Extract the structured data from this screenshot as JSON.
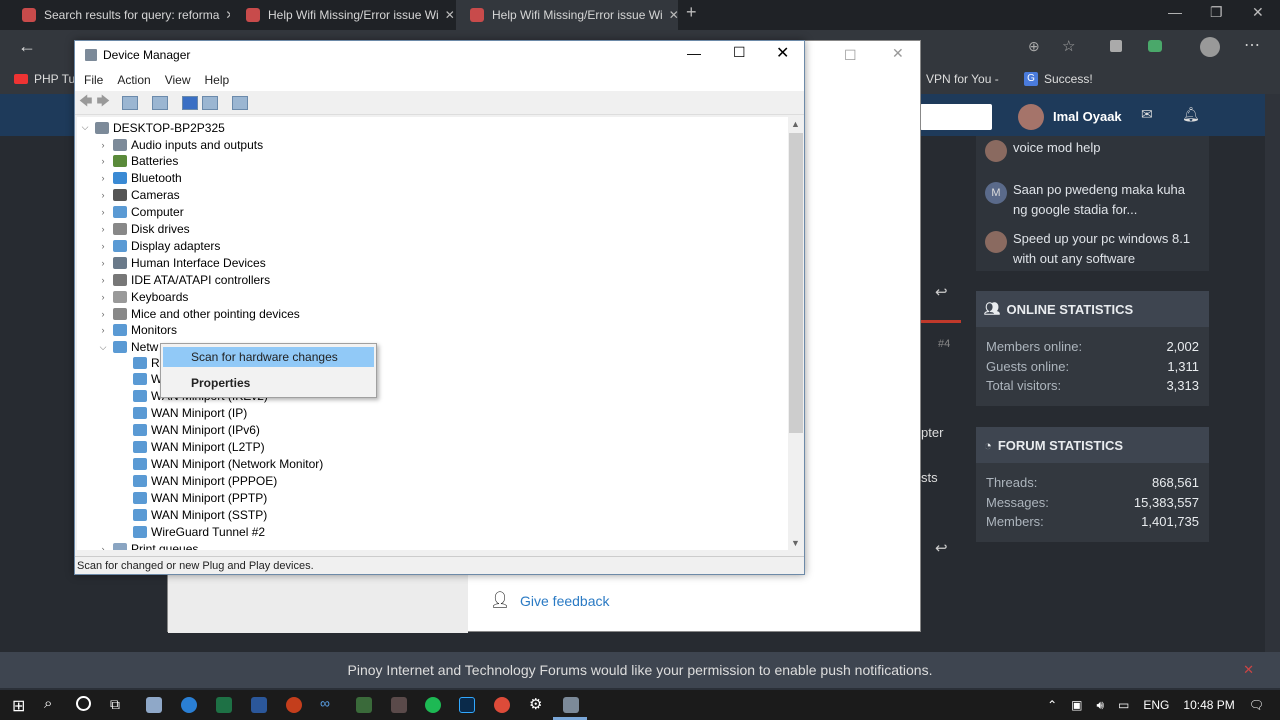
{
  "browser": {
    "tabs": [
      {
        "title": "Search results for query: reforma"
      },
      {
        "title": "Help Wifi Missing/Error issue Wi"
      },
      {
        "title": "Help Wifi Missing/Error issue Wi"
      }
    ],
    "bookmarks": [
      {
        "label": "PHP Tut"
      },
      {
        "label": "VPN for You -"
      },
      {
        "label": "Success!"
      }
    ]
  },
  "forum": {
    "user": "Imal Oyaak",
    "recent": [
      {
        "text": "voice mod help"
      },
      {
        "text": "Saan po pwedeng maka kuha ng google stadia for...",
        "avatar_letter": "M"
      },
      {
        "text": "Speed up your pc windows 8.1 with out any software"
      }
    ],
    "online": {
      "title": "ONLINE STATISTICS",
      "rows": [
        {
          "label": "Members online:",
          "value": "2,002"
        },
        {
          "label": "Guests online:",
          "value": "1,311"
        },
        {
          "label": "Total visitors:",
          "value": "3,313"
        }
      ]
    },
    "stats": {
      "title": "FORUM STATISTICS",
      "rows": [
        {
          "label": "Threads:",
          "value": "868,561"
        },
        {
          "label": "Messages:",
          "value": "15,383,557"
        },
        {
          "label": "Members:",
          "value": "1,401,735"
        }
      ]
    },
    "fragments": {
      "post_num": "#4",
      "pter": "pter",
      "sts": "sts"
    },
    "give_feedback": "Give feedback",
    "notification": "Pinoy Internet and Technology Forums would like your permission to enable push notifications."
  },
  "device_manager": {
    "title": "Device Manager",
    "menu": [
      "File",
      "Action",
      "View",
      "Help"
    ],
    "root": "DESKTOP-BP2P325",
    "categories": [
      "Audio inputs and outputs",
      "Batteries",
      "Bluetooth",
      "Cameras",
      "Computer",
      "Disk drives",
      "Display adapters",
      "Human Interface Devices",
      "IDE ATA/ATAPI controllers",
      "Keyboards",
      "Mice and other pointing devices",
      "Monitors",
      "Netw"
    ],
    "network_children": [
      "R",
      "W",
      "WAN Miniport (IKEv2)",
      "WAN Miniport (IP)",
      "WAN Miniport (IPv6)",
      "WAN Miniport (L2TP)",
      "WAN Miniport (Network Monitor)",
      "WAN Miniport (PPPOE)",
      "WAN Miniport (PPTP)",
      "WAN Miniport (SSTP)",
      "WireGuard Tunnel #2"
    ],
    "next_category": "Print queues",
    "status": "Scan for changed or new Plug and Play devices.",
    "context_menu": {
      "scan": "Scan for hardware changes",
      "properties": "Properties"
    }
  },
  "taskbar": {
    "lang": "ENG",
    "time": "10:48 PM"
  }
}
